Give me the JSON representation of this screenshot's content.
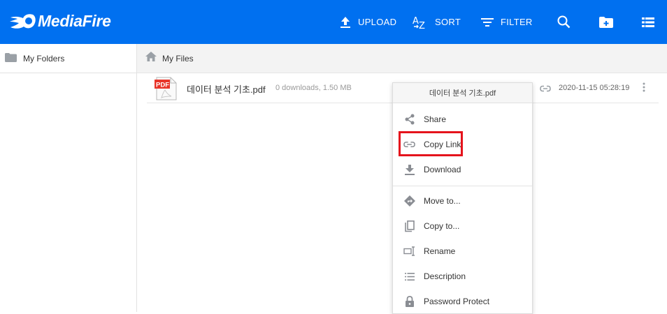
{
  "header": {
    "brand": "MediaFire",
    "upload_label": "UPLOAD",
    "sort_label": "SORT",
    "filter_label": "FILTER"
  },
  "sidebar": {
    "my_folders_label": "My Folders"
  },
  "breadcrumb": {
    "label": "My Files"
  },
  "file": {
    "name": "데이터 분석 기초.pdf",
    "meta": "0 downloads, 1.50 MB",
    "date": "2020-11-15 05:28:19",
    "badge": "PDF"
  },
  "context_menu": {
    "title": "데이터 분석 기초.pdf",
    "items": [
      {
        "label": "Share",
        "icon": "share-icon"
      },
      {
        "label": "Copy Link",
        "icon": "link-icon"
      },
      {
        "label": "Download",
        "icon": "download-icon"
      },
      {
        "label": "Move to...",
        "icon": "move-icon"
      },
      {
        "label": "Copy to...",
        "icon": "copy-icon"
      },
      {
        "label": "Rename",
        "icon": "rename-icon"
      },
      {
        "label": "Description",
        "icon": "description-icon"
      },
      {
        "label": "Password Protect",
        "icon": "lock-icon"
      }
    ]
  },
  "colors": {
    "brand": "#0070f0",
    "highlight": "#e5131c",
    "icon_gray": "#8a8d93"
  }
}
